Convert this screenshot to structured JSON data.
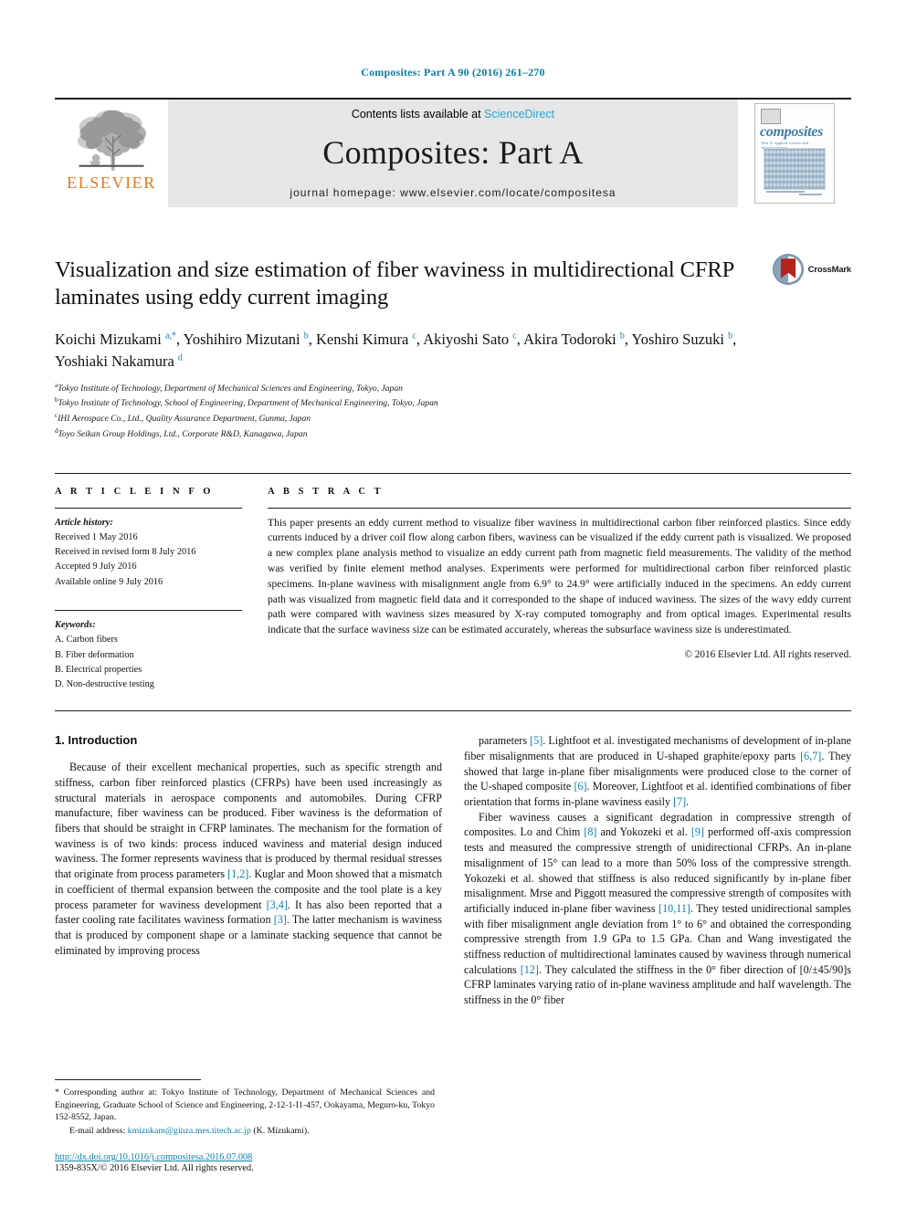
{
  "running_head": "Composites: Part A 90 (2016) 261–270",
  "masthead": {
    "publisher_word": "ELSEVIER",
    "contents_prefix": "Contents lists available at ",
    "contents_link": "ScienceDirect",
    "journal_title": "Composites: Part A",
    "homepage": "journal homepage: www.elsevier.com/locate/compositesa",
    "cover": {
      "word": "composites",
      "subtitle": "Part A: applied science and manufacturing"
    }
  },
  "article": {
    "title": "Visualization and size estimation of fiber waviness in multidirectional CFRP laminates using eddy current imaging",
    "crossmark_label": "CrossMark",
    "authors_html": "Koichi Mizukami <sup>a,*</sup>, Yoshihiro Mizutani <sup>b</sup>, Kenshi Kimura <sup>c</sup>, Akiyoshi Sato <sup>c</sup>, Akira Todoroki <sup>b</sup>, Yoshiro Suzuki <sup>b</sup>, Yoshiaki Nakamura <sup>d</sup>",
    "affiliations": [
      {
        "mark": "a",
        "text": "Tokyo Institute of Technology, Department of Mechanical Sciences and Engineering, Tokyo, Japan"
      },
      {
        "mark": "b",
        "text": "Tokyo Institute of Technology, School of Engineering, Department of Mechanical Engineering, Tokyo, Japan"
      },
      {
        "mark": "c",
        "text": "IHI Aerospace Co., Ltd., Quality Assurance Department, Gunma, Japan"
      },
      {
        "mark": "d",
        "text": "Toyo Seikan Group Holdings, Ltd., Corporate R&D, Kanagawa, Japan"
      }
    ]
  },
  "article_info": {
    "heading": "A R T I C L E   I N F O",
    "history_label": "Article history:",
    "history": [
      "Received 1 May 2016",
      "Received in revised form 8 July 2016",
      "Accepted 9 July 2016",
      "Available online 9 July 2016"
    ],
    "keywords_label": "Keywords:",
    "keywords": [
      "A. Carbon fibers",
      "B. Fiber deformation",
      "B. Electrical properties",
      "D. Non-destructive testing"
    ]
  },
  "abstract": {
    "heading": "A B S T R A C T",
    "text": "This paper presents an eddy current method to visualize fiber waviness in multidirectional carbon fiber reinforced plastics. Since eddy currents induced by a driver coil flow along carbon fibers, waviness can be visualized if the eddy current path is visualized. We proposed a new complex plane analysis method to visualize an eddy current path from magnetic field measurements. The validity of the method was verified by finite element method analyses. Experiments were performed for multidirectional carbon fiber reinforced plastic specimens. In-plane waviness with misalignment angle from 6.9° to 24.9° were artificially induced in the specimens. An eddy current path was visualized from magnetic field data and it corresponded to the shape of induced waviness. The sizes of the wavy eddy current path were compared with waviness sizes measured by X-ray computed tomography and from optical images. Experimental results indicate that the surface waviness size can be estimated accurately, whereas the subsurface waviness size is underestimated.",
    "copyright": "© 2016 Elsevier Ltd. All rights reserved."
  },
  "body": {
    "section_heading": "1. Introduction",
    "left_paragraphs": [
      "Because of their excellent mechanical properties, such as specific strength and stiffness, carbon fiber reinforced plastics (CFRPs) have been used increasingly as structural materials in aerospace components and automobiles. During CFRP manufacture, fiber waviness can be produced. Fiber waviness is the deformation of fibers that should be straight in CFRP laminates. The mechanism for the formation of waviness is of two kinds: process induced waviness and material design induced waviness. The former represents waviness that is produced by thermal residual stresses that originate from process parameters [1,2]. Kuglar and Moon showed that a mismatch in coefficient of thermal expansion between the composite and the tool plate is a key process parameter for waviness development [3,4]. It has also been reported that a faster cooling rate facilitates waviness formation [3]. The latter mechanism is waviness that is produced by component shape or a laminate stacking sequence that cannot be eliminated by improving process"
    ],
    "right_paragraphs": [
      "parameters [5]. Lightfoot et al. investigated mechanisms of development of in-plane fiber misalignments that are produced in U-shaped graphite/epoxy parts [6,7]. They showed that large in-plane fiber misalignments were produced close to the corner of the U-shaped composite [6]. Moreover, Lightfoot et al. identified combinations of fiber orientation that forms in-plane waviness easily [7].",
      "Fiber waviness causes a significant degradation in compressive strength of composites. Lo and Chim [8] and Yokozeki et al. [9] performed off-axis compression tests and measured the compressive strength of unidirectional CFRPs. An in-plane misalignment of 15° can lead to a more than 50% loss of the compressive strength. Yokozeki et al. showed that stiffness is also reduced significantly by in-plane fiber misalignment. Mrse and Piggott measured the compressive strength of composites with artificially induced in-plane fiber waviness [10,11]. They tested unidirectional samples with fiber misalignment angle deviation from 1° to 6° and obtained the corresponding compressive strength from 1.9 GPa to 1.5 GPa. Chan and Wang investigated the stiffness reduction of multidirectional laminates caused by waviness through numerical calculations [12]. They calculated the stiffness in the 0° fiber direction of [0/±45/90]s CFRP laminates varying ratio of in-plane waviness amplitude and half wavelength. The stiffness in the 0° fiber"
    ]
  },
  "footnotes": {
    "corresponding": "* Corresponding author at: Tokyo Institute of Technology, Department of Mechanical Sciences and Engineering, Graduate School of Science and Engineering, 2-12-1-I1-457, Ookayama, Meguro-ku, Tokyo 152-8552, Japan.",
    "email_label": "E-mail address:",
    "email": "kmizukam@ginza.mes.titech.ac.jp",
    "email_owner": "(K. Mizukami).",
    "doi": "http://dx.doi.org/10.1016/j.compositesa.2016.07.008",
    "issn_line": "1359-835X/© 2016 Elsevier Ltd. All rights reserved."
  },
  "colors": {
    "link_blue": "#0d7fae",
    "elsevier_orange": "#e87722",
    "sciencedirect_blue": "#2da3d3"
  }
}
